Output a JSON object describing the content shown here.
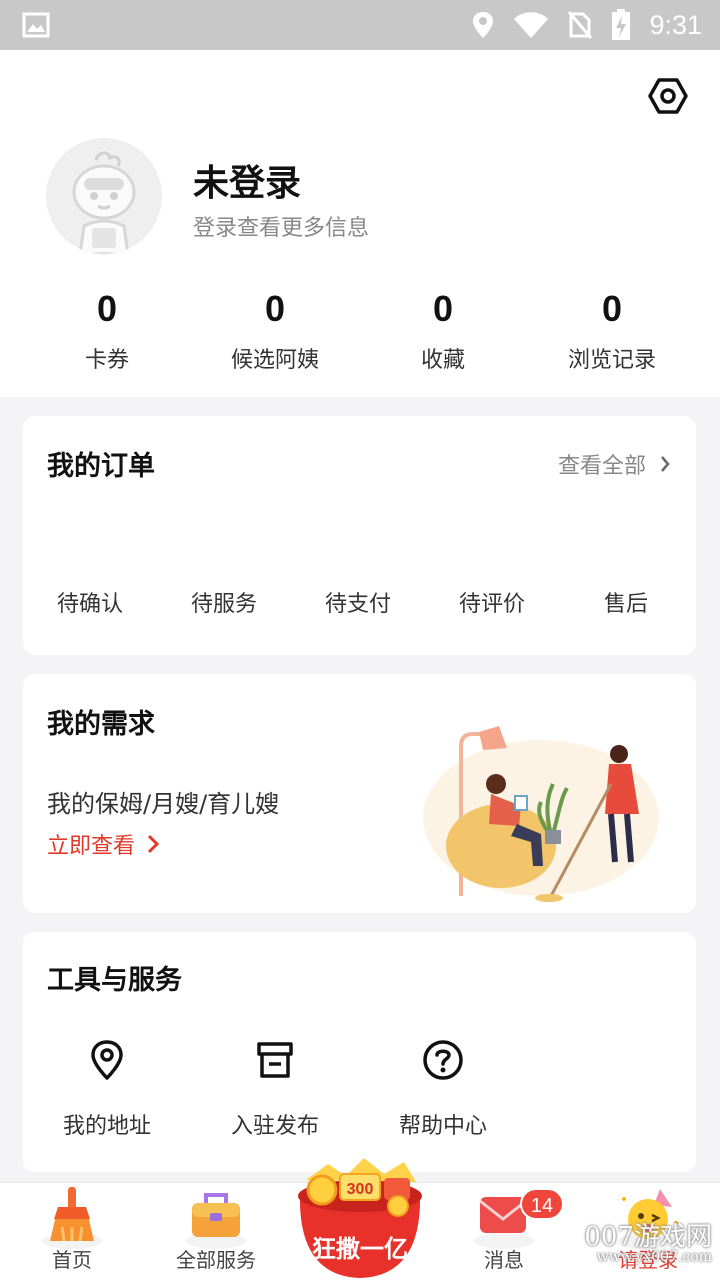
{
  "status_bar": {
    "time": "9:31",
    "icons": [
      "image-icon",
      "location-icon",
      "wifi-icon",
      "no-sim-icon",
      "battery-charging-icon"
    ]
  },
  "profile": {
    "name": "未登录",
    "subtitle": "登录查看更多信息",
    "settings_icon": "hexagon-gear-icon",
    "stats": [
      {
        "value": "0",
        "label": "卡券"
      },
      {
        "value": "0",
        "label": "候选阿姨"
      },
      {
        "value": "0",
        "label": "收藏"
      },
      {
        "value": "0",
        "label": "浏览记录"
      }
    ]
  },
  "orders": {
    "title": "我的订单",
    "view_all": "查看全部",
    "tabs": [
      "待确认",
      "待服务",
      "待支付",
      "待评价",
      "售后"
    ]
  },
  "demands": {
    "title": "我的需求",
    "description": "我的保姆/月嫂/育儿嫂",
    "link": "立即查看"
  },
  "tools": {
    "title": "工具与服务",
    "items": [
      {
        "label": "我的地址",
        "icon": "location-pin-icon"
      },
      {
        "label": "入驻发布",
        "icon": "store-icon"
      },
      {
        "label": "帮助中心",
        "icon": "help-icon"
      }
    ]
  },
  "bottom_nav": {
    "items": [
      {
        "label": "首页",
        "icon": "broom-icon"
      },
      {
        "label": "全部服务",
        "icon": "toolbox-icon"
      },
      {
        "label": "狂撒一亿",
        "icon": "red-packet-promo-icon"
      },
      {
        "label": "消息",
        "icon": "envelope-icon"
      },
      {
        "label": "请登录",
        "icon": "party-face-icon"
      }
    ],
    "message_badge": "14",
    "promo_art_text": "300"
  },
  "watermark": {
    "text": "007游戏网",
    "sub": "www.yx007.com"
  },
  "colors": {
    "accent_red": "#e0392b",
    "badge_red": "#f0453a",
    "status_bar": "#c8c8c8"
  }
}
